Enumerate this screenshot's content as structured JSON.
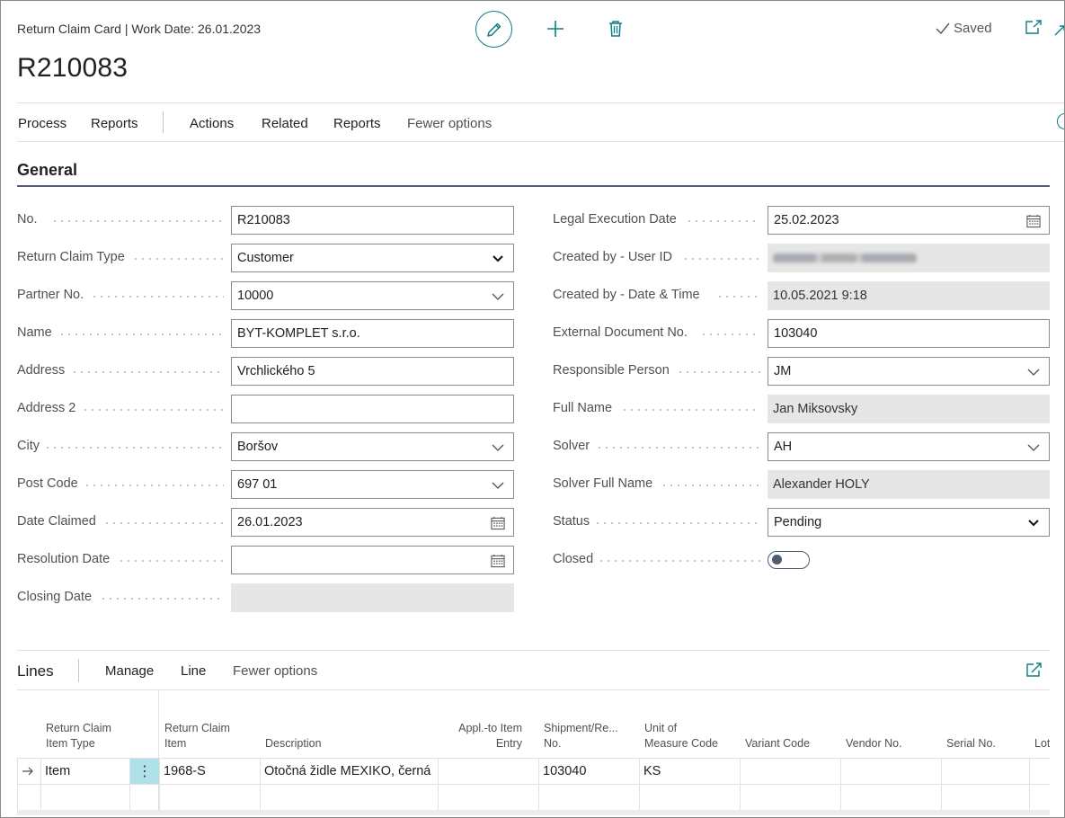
{
  "header": {
    "breadcrumb": "Return Claim Card | Work Date: 26.01.2023",
    "title": "R210083",
    "saved_label": "Saved"
  },
  "actionbar": {
    "items": [
      "Process",
      "Reports",
      "Actions",
      "Related",
      "Reports",
      "Fewer options"
    ]
  },
  "general": {
    "title": "General",
    "left": [
      {
        "label": "No.",
        "value": "R210083",
        "kind": "text"
      },
      {
        "label": "Return Claim Type",
        "value": "Customer",
        "kind": "select"
      },
      {
        "label": "Partner No.",
        "value": "10000",
        "kind": "lookup"
      },
      {
        "label": "Name",
        "value": "BYT-KOMPLET s.r.o.",
        "kind": "text"
      },
      {
        "label": "Address",
        "value": "Vrchlického 5",
        "kind": "text"
      },
      {
        "label": "Address 2",
        "value": "",
        "kind": "text"
      },
      {
        "label": "City",
        "value": "Boršov",
        "kind": "lookup"
      },
      {
        "label": "Post Code",
        "value": "697 01",
        "kind": "lookup"
      },
      {
        "label": "Date Claimed",
        "value": "26.01.2023",
        "kind": "date"
      },
      {
        "label": "Resolution Date",
        "value": "",
        "kind": "date"
      },
      {
        "label": "Closing Date",
        "value": "",
        "kind": "readonly"
      }
    ],
    "right": [
      {
        "label": "Legal Execution Date",
        "value": "25.02.2023",
        "kind": "date"
      },
      {
        "label": "Created by - User ID",
        "value": "",
        "kind": "blurred"
      },
      {
        "label": "Created by - Date & Time",
        "value": "10.05.2021 9:18",
        "kind": "readonly"
      },
      {
        "label": "External Document No.",
        "value": "103040",
        "kind": "text"
      },
      {
        "label": "Responsible Person",
        "value": "JM",
        "kind": "lookup"
      },
      {
        "label": "Full Name",
        "value": "Jan Miksovsky",
        "kind": "readonly"
      },
      {
        "label": "Solver",
        "value": "AH",
        "kind": "lookup"
      },
      {
        "label": "Solver Full Name",
        "value": "Alexander HOLY",
        "kind": "readonly"
      },
      {
        "label": "Status",
        "value": "Pending",
        "kind": "select"
      },
      {
        "label": "Closed",
        "value": "",
        "kind": "toggle"
      }
    ]
  },
  "lines": {
    "title": "Lines",
    "actions": [
      "Manage",
      "Line",
      "Fewer options"
    ],
    "columns": [
      {
        "l1": "Return Claim",
        "l2": "Item Type"
      },
      {
        "l1": "Return Claim",
        "l2": "Item"
      },
      {
        "l1": "",
        "l2": "Description"
      },
      {
        "l1": "Appl.-to Item",
        "l2": "Entry"
      },
      {
        "l1": "Shipment/Re...",
        "l2": "No."
      },
      {
        "l1": "Unit of",
        "l2": "Measure Code"
      },
      {
        "l1": "",
        "l2": "Variant Code"
      },
      {
        "l1": "",
        "l2": "Vendor No."
      },
      {
        "l1": "",
        "l2": "Serial No."
      },
      {
        "l1": "",
        "l2": "Lot"
      }
    ],
    "rows": [
      {
        "type": "Item",
        "item": "1968-S",
        "description": "Otočná židle MEXIKO, černá",
        "appl": "",
        "shipment": "103040",
        "uom": "KS",
        "variant": "",
        "vendor": "",
        "serial": ""
      }
    ]
  }
}
